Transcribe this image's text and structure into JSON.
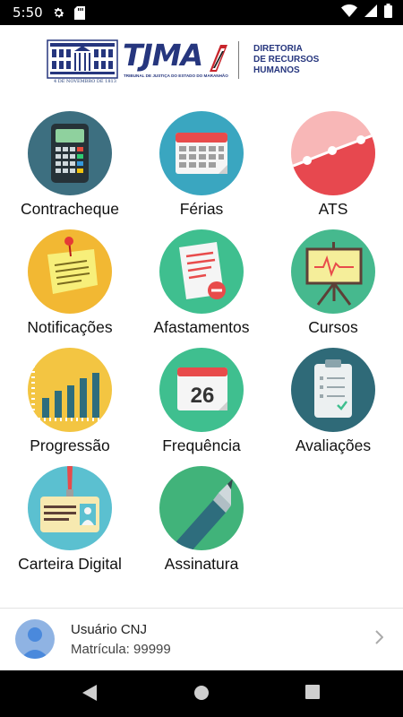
{
  "status_bar": {
    "time": "5:50"
  },
  "header": {
    "logo_text": "TJMA",
    "logo_subtitle": "TRIBUNAL DE JUSTIÇA DO ESTADO DO MARANHÃO",
    "founded_text": "4 DE NOVEMBRO DE 1813",
    "department_line1": "DIRETORIA",
    "department_line2": "DE RECURSOS",
    "department_line3": "HUMANOS"
  },
  "menu": [
    {
      "label": "Contracheque",
      "icon": "calculator-icon",
      "color": "#3d6f80"
    },
    {
      "label": "Férias",
      "icon": "calendar-icon",
      "color": "#3aa6c0"
    },
    {
      "label": "ATS",
      "icon": "line-chart-icon",
      "color": "#e7484f"
    },
    {
      "label": "Notificações",
      "icon": "sticky-note-icon",
      "color": "#f2b833"
    },
    {
      "label": "Afastamentos",
      "icon": "document-remove-icon",
      "color": "#3fbf8f"
    },
    {
      "label": "Cursos",
      "icon": "presentation-board-icon",
      "color": "#46b98e"
    },
    {
      "label": "Progressão",
      "icon": "bar-chart-icon",
      "color": "#f3c542"
    },
    {
      "label": "Frequência",
      "icon": "calendar-26-icon",
      "color": "#3fbf8f",
      "day": "26"
    },
    {
      "label": "Avaliações",
      "icon": "clipboard-icon",
      "color": "#2f6a78"
    },
    {
      "label": "Carteira Digital",
      "icon": "id-badge-icon",
      "color": "#5bc0d0"
    },
    {
      "label": "Assinatura",
      "icon": "pen-icon",
      "color": "#41b37a"
    }
  ],
  "user": {
    "name": "Usuário CNJ",
    "matricula": "Matrícula: 99999"
  }
}
